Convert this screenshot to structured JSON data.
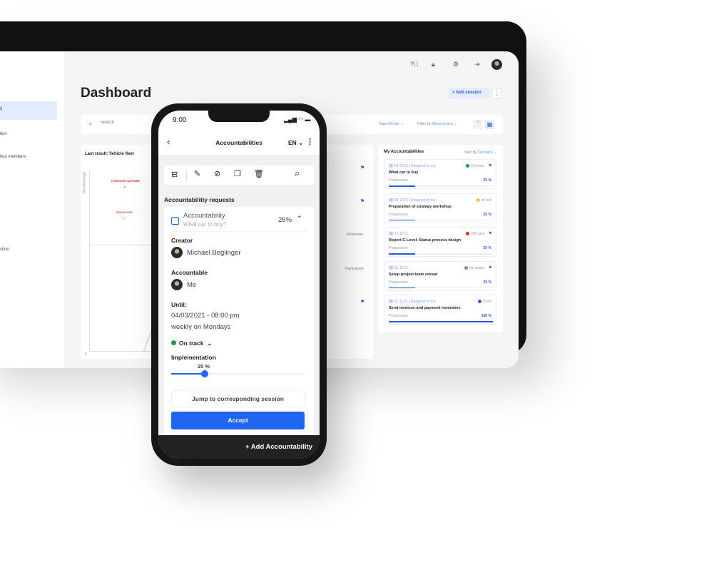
{
  "tablet": {
    "sidebar": {
      "items": [
        {
          "label": "d",
          "active": true
        },
        {
          "label": "tion"
        },
        {
          "label": "tion members"
        },
        {
          "label": "ction"
        }
      ]
    },
    "header": {
      "title": "Dashboard",
      "icons": [
        "help-icon",
        "lock-icon",
        "gear-icon",
        "logout-icon",
        "avatar"
      ],
      "add_session": "+ Add session"
    },
    "search": {
      "placeholder": "Search",
      "date_label": "Date",
      "date_value": "Month",
      "filter_label": "Filter by",
      "filter_value": "Most recent"
    },
    "result_panel": {
      "title": "Last result: Vehicle fleet",
      "y_axis_label": "Disadvantage",
      "origin_tick": "0",
      "points": [
        {
          "label": "PORSCHE CAYENNE",
          "marker": "×"
        },
        {
          "label": "VOLVO V70",
          "marker": "☆"
        }
      ]
    },
    "middle_panel": {
      "labels": [
        "Moderate",
        "Participate"
      ]
    },
    "accountabilities": {
      "title": "My Accountabilities",
      "sort_label": "Sort by",
      "sort_value": "On track",
      "progress_label": "Progression",
      "items": [
        {
          "date": "03.12.21",
          "assigned": "| Assigned to me",
          "status": "On track",
          "status_color": "#1a9a4b",
          "title": "What car to buy",
          "progress": "25 %",
          "pct": 25,
          "bookmark": true
        },
        {
          "date": "08.12.21",
          "assigned": "| Assigned to me",
          "status": "At risk",
          "status_color": "#f5c242",
          "title": "Preparation of strategy workshop",
          "progress": "25 %",
          "pct": 25,
          "bookmark": false
        },
        {
          "date": "17.12.21",
          "assigned": "",
          "status": "Off track",
          "status_color": "#e0201b",
          "title": "Report C-Level: Status process design",
          "progress": "25 %",
          "pct": 25,
          "bookmark": true
        },
        {
          "date": "21.12.21",
          "assigned": "",
          "status": "No status",
          "status_color": "#8a8a8a",
          "title": "Setup project team retreat",
          "progress": "25 %",
          "pct": 25,
          "bookmark": true
        },
        {
          "date": "01.12.21",
          "assigned": "| Assigned to me",
          "status": "Done",
          "status_color": "#2a5bd7",
          "title": "Send invoices and payment reminders",
          "progress": "100 %",
          "pct": 100,
          "bookmark": false
        }
      ]
    }
  },
  "phone": {
    "time": "9:00",
    "title": "Accountabilities",
    "language": "EN",
    "section_title": "Accountabilitiy requests",
    "item": {
      "type": "Accountability",
      "subtitle": "What car to buy?",
      "percent": "25%"
    },
    "creator_label": "Creator",
    "creator": "Michael Beglinger",
    "accountable_label": "Accountable",
    "accountable": "Me",
    "until_label": "Until:",
    "until": "04/03/2021 - 08:00 pm",
    "recurrence": "weekly on Mondays",
    "status": "On track",
    "status_color": "#1a9a4b",
    "implementation_label": "Implementation",
    "implementation_value": "25 %",
    "implementation_pct": 25,
    "jump_button": "Jump to corresponding session",
    "accept_button": "Accept",
    "add_button": "+ Add Accountability",
    "accent": "#1f66f2"
  }
}
